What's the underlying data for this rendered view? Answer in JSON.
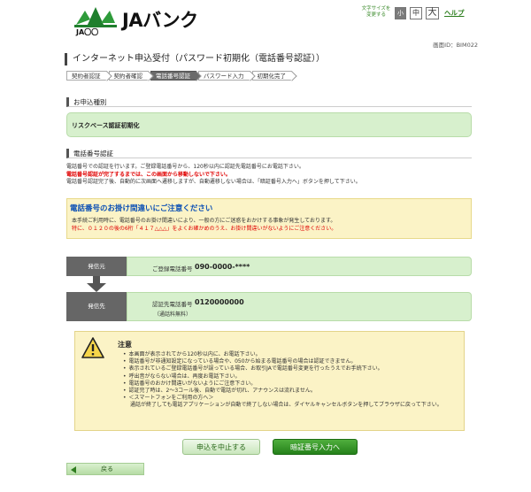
{
  "header": {
    "logo_text": "JAバンク",
    "logo_sub": "JA〇〇",
    "fontsize_label": "文字サイズを変更する",
    "fontsize_small": "小",
    "fontsize_mid": "中",
    "fontsize_big": "大",
    "help": "ヘルプ"
  },
  "screen_id": "画面ID：BIM022",
  "page_title": "インターネット申込受付（パスワード初期化（電話番号認証））",
  "steps": [
    {
      "label": "契約者認証",
      "active": false
    },
    {
      "label": "契約者確認",
      "active": false
    },
    {
      "label": "電話番号認証",
      "active": true
    },
    {
      "label": "パスワード入力",
      "active": false
    },
    {
      "label": "初期化完了",
      "active": false
    }
  ],
  "type_section": {
    "heading": "お申込種別",
    "value": "リスクベース認証初期化"
  },
  "phone_section": {
    "heading": "電話番号認証",
    "line1": "電話番号での認証を行います。ご登録電話番号から、120秒以内に認証先電話番号にお電話下さい。",
    "line2_red": "電話番号認証が完了するまでは、この画面から移動しないで下さい。",
    "line3": "電話番号認証完了後、自動的に次画面へ遷移しますが、自動遷移しない場合は、「暗証番号入力へ」ボタンを押して下さい。"
  },
  "warning": {
    "title": "電話番号のお掛け間違いにご注意ください",
    "body1": "本手続ご利用時に、電話番号のお掛け間違いにより、一般の方にご迷惑をおかけする事象が発生しております。",
    "body2_red": "特に、０１２０の後の6桁「４１７△△△」をよくお確かめのうえ、お掛け間違いがないようにご注意ください。"
  },
  "caller": {
    "label": "発信元",
    "field": "ご登録電話番号",
    "number": "090-0000-****"
  },
  "callee": {
    "label": "発信先",
    "field": "認証先電話番号",
    "number": "0120000000",
    "note": "（通話料無料）"
  },
  "caution": {
    "title": "注意",
    "items": [
      {
        "text": "本画面が表示されてから120秒以内に、お電話下さい。",
        "cont": false
      },
      {
        "text": "電話番号が非通知設定になっている場合や、050から始まる電話番号の場合は認証できません。",
        "cont": false
      },
      {
        "text": "表示されているご登録電話番号が誤っている場合、お取引JAで電話番号変更を行ったうえでお手続下さい。",
        "cont": false
      },
      {
        "text": "呼出音がならない場合は、再度お電話下さい。",
        "cont": false
      },
      {
        "text": "電話番号のおかけ間違いがないようにご注意下さい。",
        "cont": false
      },
      {
        "text": "認証完了時は、2～3コール後、自動で電話が切れ、アナウンスは流れません。",
        "cont": false
      },
      {
        "text": "＜スマートフォンをご利用の方へ＞",
        "cont": false
      },
      {
        "text": "通話が終了しても電話アプリケーションが自動で終了しない場合は、ダイヤルキャンセルボタンを押してブラウザに戻って下さい。",
        "cont": true
      }
    ]
  },
  "buttons": {
    "cancel": "申込を中止する",
    "next": "暗証番号入力へ",
    "back": "戻る"
  },
  "colors": {
    "brand_green": "#2a7d1c",
    "panel_green": "#d7f0cd",
    "notice_yellow": "#fbf3c6",
    "alert_red": "#e00000",
    "notice_blue": "#0a4fb5"
  }
}
